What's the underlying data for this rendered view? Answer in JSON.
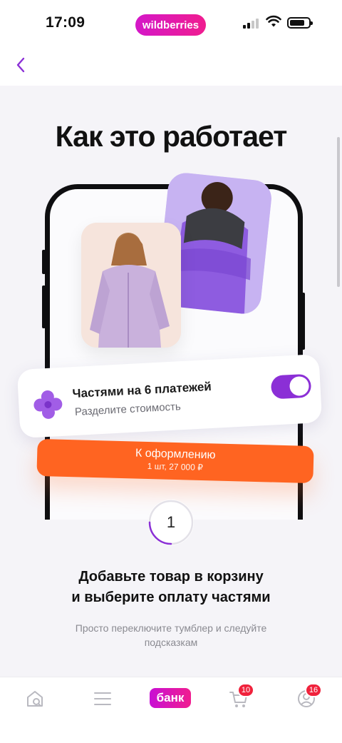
{
  "status_bar": {
    "time": "17:09",
    "brand": "wildberries"
  },
  "header": {
    "back_icon": "chevron-left-icon"
  },
  "main": {
    "title": "Как это работает",
    "toggle_card": {
      "title": "Частями на 6 платежей",
      "subtitle": "Разделите стоимость",
      "toggle_on": true
    },
    "checkout_button": {
      "label": "К оформлению",
      "sublabel": "1 шт, 27 000 ₽"
    },
    "step": {
      "number": "1",
      "progress": 0.25
    },
    "heading_line1": "Добавьте товар в корзину",
    "heading_line2": "и выберите оплату частями",
    "description_line1": "Просто переключите тумблер и следуйте",
    "description_line2": "подсказкам"
  },
  "bottom_nav": {
    "items": [
      {
        "icon": "home-search-icon"
      },
      {
        "icon": "catalog-menu-icon"
      },
      {
        "label": "банк"
      },
      {
        "icon": "cart-icon",
        "badge": "10"
      },
      {
        "icon": "profile-icon",
        "badge": "16"
      }
    ]
  },
  "colors": {
    "accent_purple": "#8b2fd6",
    "accent_orange": "#ff6421",
    "brand_pink": "#e619b0",
    "badge_red": "#f0223c"
  }
}
